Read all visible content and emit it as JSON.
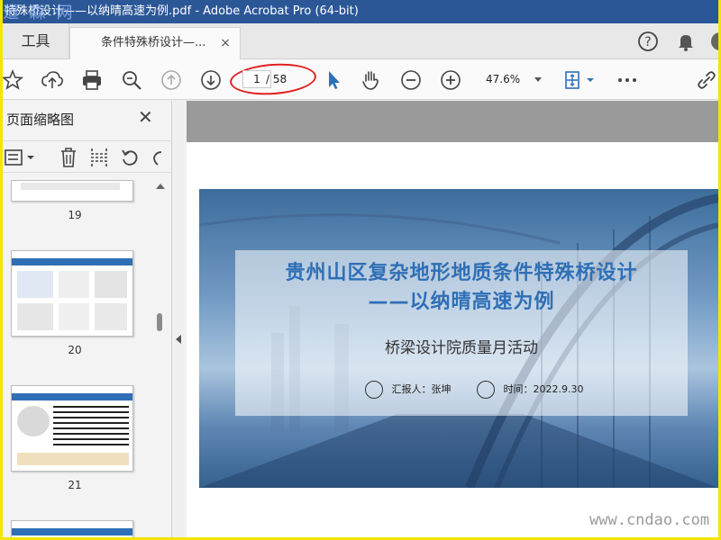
{
  "window": {
    "title": "特殊桥设计——以纳晴高速为例.pdf - Adobe Acrobat Pro (64-bit)",
    "watermark_top": "道 森 网"
  },
  "tabs": {
    "tools_label": "工具",
    "doc_label": "条件特殊桥设计—...",
    "close_glyph": "×"
  },
  "toolbar": {
    "current_page": "1",
    "total_pages": "/ 58",
    "zoom": "47.6%"
  },
  "thumbnail_panel": {
    "title": "页面缩略图",
    "close_glyph": "✕",
    "pages": [
      {
        "label": "19"
      },
      {
        "label": "20"
      },
      {
        "label": "21"
      }
    ]
  },
  "slide": {
    "title_line1": "贵州山区复杂地形地质条件特殊桥设计",
    "title_line2": "——以纳晴高速为例",
    "subtitle": "桥梁设计院质量月活动",
    "reporter": "汇报人：张坤",
    "date": "时间：2022.9.30"
  },
  "watermark_bottom": "www.cndao.com",
  "colors": {
    "titlebar": "#2b5797",
    "accent_blue": "#2f6fb5",
    "highlight_red": "#e02020",
    "border_yellow": "#f2e600"
  }
}
